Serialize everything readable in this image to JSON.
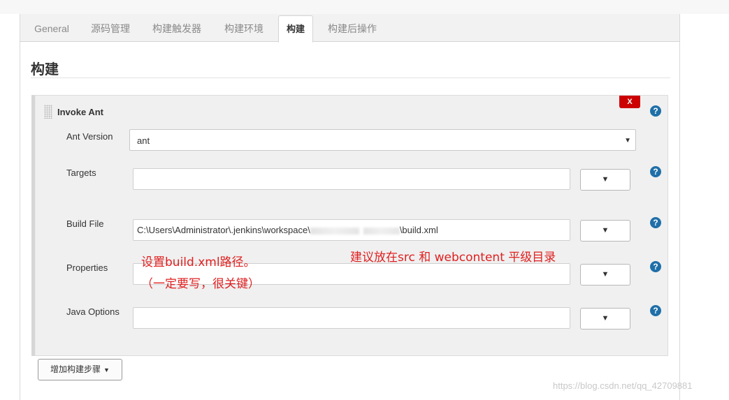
{
  "tabs": [
    {
      "label": "General",
      "active": false
    },
    {
      "label": "源码管理",
      "active": false
    },
    {
      "label": "构建触发器",
      "active": false
    },
    {
      "label": "构建环境",
      "active": false
    },
    {
      "label": "构建",
      "active": true
    },
    {
      "label": "构建后操作",
      "active": false
    }
  ],
  "section": {
    "title": "构建"
  },
  "builder": {
    "title": "Invoke Ant",
    "delete_label": "X",
    "help_glyph": "?",
    "ant_version": {
      "label": "Ant Version",
      "value": "ant"
    },
    "targets": {
      "label": "Targets",
      "value": ""
    },
    "build_file": {
      "label": "Build File",
      "value_prefix": "C:\\Users\\Administrator\\.jenkins\\workspace\\",
      "value_suffix": "\\build.xml"
    },
    "properties": {
      "label": "Properties",
      "value": ""
    },
    "java_options": {
      "label": "Java Options",
      "value": ""
    },
    "dropdown_glyph": "▼"
  },
  "annotations": {
    "set_path": "设置build.xml路径。",
    "must_write": "（一定要写，很关键）",
    "suggestion": "建议放在src 和 webcontent 平级目录"
  },
  "add_step": {
    "label": "增加构建步骤",
    "caret": "▼"
  },
  "watermark": "https://blog.csdn.net/qq_42709881",
  "colors": {
    "delete": "#cc0000",
    "help": "#1f6fa8",
    "annotation": "#e02020"
  }
}
